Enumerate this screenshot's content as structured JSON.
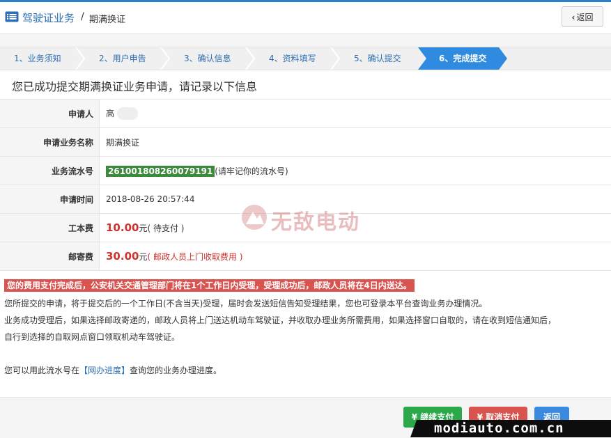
{
  "header": {
    "section": "驾驶证业务",
    "separator": "/",
    "page": "期满换证",
    "back_label": "返回"
  },
  "steps": [
    {
      "label": "1、业务须知",
      "active": false
    },
    {
      "label": "2、用户申告",
      "active": false
    },
    {
      "label": "3、确认信息",
      "active": false
    },
    {
      "label": "4、资料填写",
      "active": false
    },
    {
      "label": "5、确认提交",
      "active": false
    },
    {
      "label": "6、完成提交",
      "active": true
    }
  ],
  "title": "您已成功提交期满换证业务申请，请记录以下信息",
  "info": {
    "applicant_label": "申请人",
    "applicant_value": "高",
    "business_label": "申请业务名称",
    "business_value": "期满换证",
    "serial_label": "业务流水号",
    "serial_value": "261001808260079191",
    "serial_hint": "(请牢记你的流水号)",
    "time_label": "申请时间",
    "time_value": "2018-08-26 20:57:44",
    "cost_label": "工本费",
    "cost_value": "10.00",
    "cost_unit": "元",
    "cost_note": "( 待支付 )",
    "postage_label": "邮寄费",
    "postage_value": "30.00",
    "postage_unit": "元",
    "postage_note": "( 邮政人员上门收取费用 )"
  },
  "watermark": "无敌电动",
  "alert": "您的费用支付完成后，公安机关交通管理部门将在1个工作日内受理，受理成功后，邮政人员将在4日内送达。",
  "paragraphs": {
    "p1": "您所提交的申请，将于提交后的一个工作日(不含当天)受理，届时会发送短信告知受理结果，您也可登录本平台查询业务办理情况。",
    "p2": "业务成功受理后，如果选择邮政寄递的，邮政人员将上门送达机动车驾驶证，并收取办理业务所需费用，如果选择窗口自取的，请在收到短信通知后，",
    "p3": "自行到选择的自取网点窗口领取机动车驾驶证。",
    "p4_prefix": "您可以用此流水号在",
    "p4_link": "【网办进度】",
    "p4_suffix": "查询您的业务办理进度。"
  },
  "buttons": {
    "continue_pay": "¥ 继续支付",
    "cancel_pay": "¥ 取消支付",
    "back": "返回"
  },
  "brand": "modiauto.com.cn",
  "colors": {
    "accent": "#2c6fb5",
    "active_step": "#2f8be0",
    "alert": "#d9534f",
    "serial": "#3c8a3c",
    "fee": "#d0312d"
  }
}
